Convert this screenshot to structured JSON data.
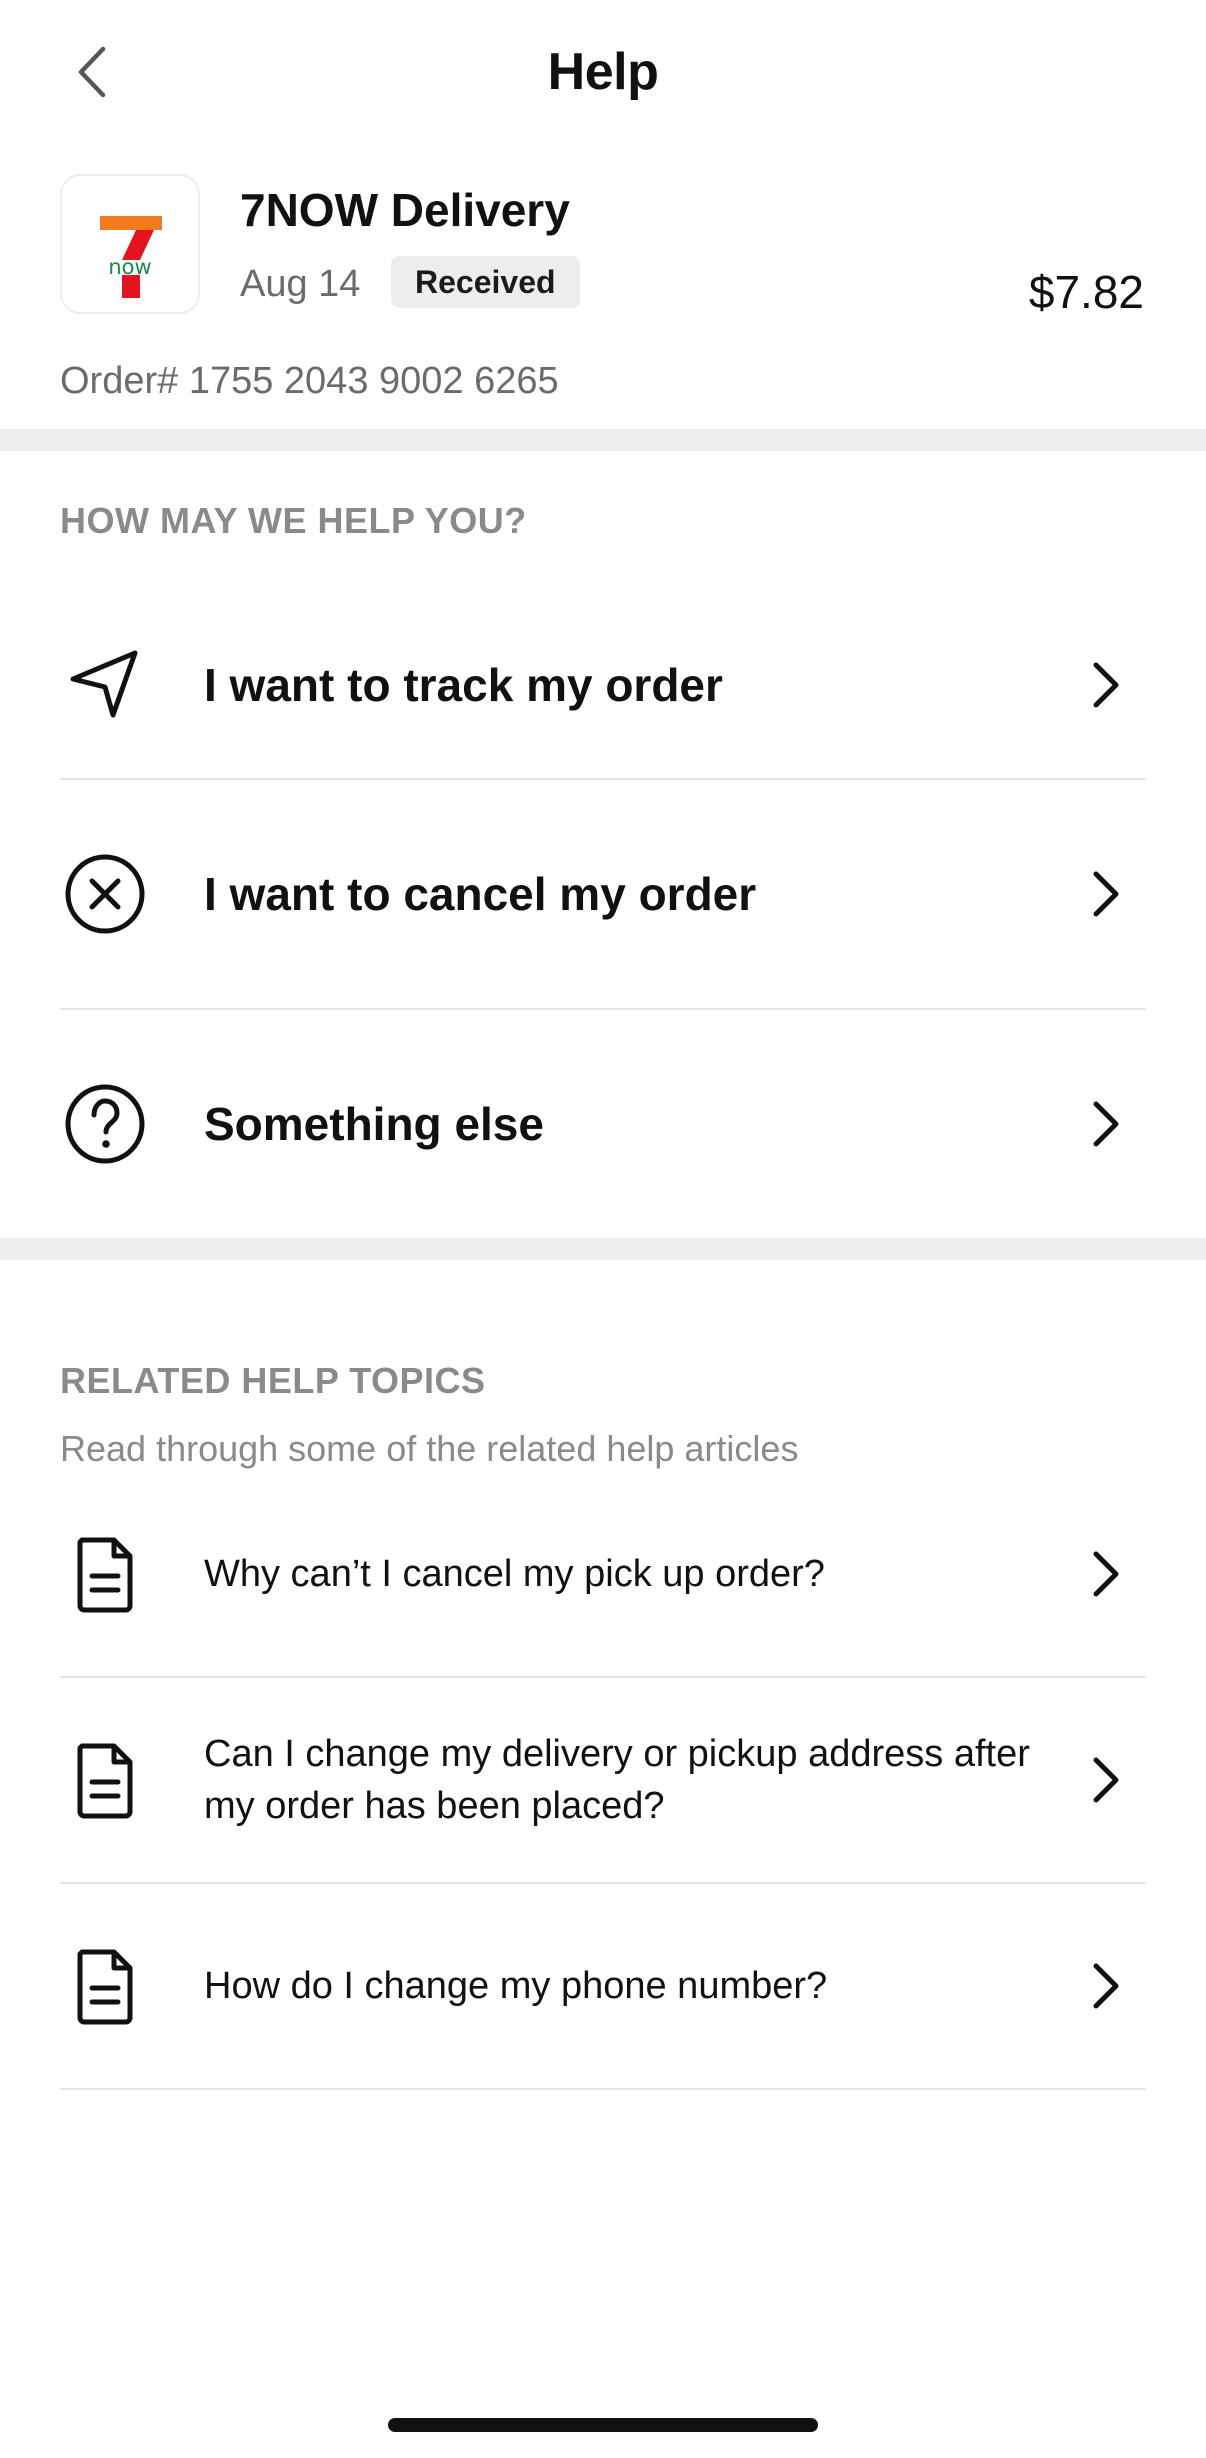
{
  "header": {
    "title": "Help",
    "back_icon": "chevron-left-icon"
  },
  "order": {
    "store_name": "7NOW Delivery",
    "date": "Aug 14",
    "status": "Received",
    "price": "$7.82",
    "order_number": "Order# 1755 2043 9002 6265",
    "logo": {
      "text": "now",
      "colors": {
        "orange": "#f47a20",
        "red": "#e3141f",
        "green": "#1a8a4a"
      }
    }
  },
  "help_section": {
    "label": "HOW MAY WE HELP YOU?",
    "items": [
      {
        "label": "I want to track my order",
        "icon": "navigation-arrow-icon"
      },
      {
        "label": "I want to cancel my order",
        "icon": "cancel-circle-icon"
      },
      {
        "label": "Something else",
        "icon": "question-circle-icon"
      }
    ]
  },
  "related_section": {
    "label": "RELATED HELP TOPICS",
    "subtitle": "Read through some of the related help articles",
    "items": [
      {
        "label": "Why can’t I cancel my pick up order?",
        "icon": "document-icon"
      },
      {
        "label": "Can I change my delivery or pickup address after my order has been placed?",
        "icon": "document-icon"
      },
      {
        "label": "How do I change my phone number?",
        "icon": "document-icon"
      }
    ]
  },
  "colors": {
    "divider": "#efefef",
    "muted_text": "#8a8a8a",
    "badge_bg": "#ededed"
  }
}
